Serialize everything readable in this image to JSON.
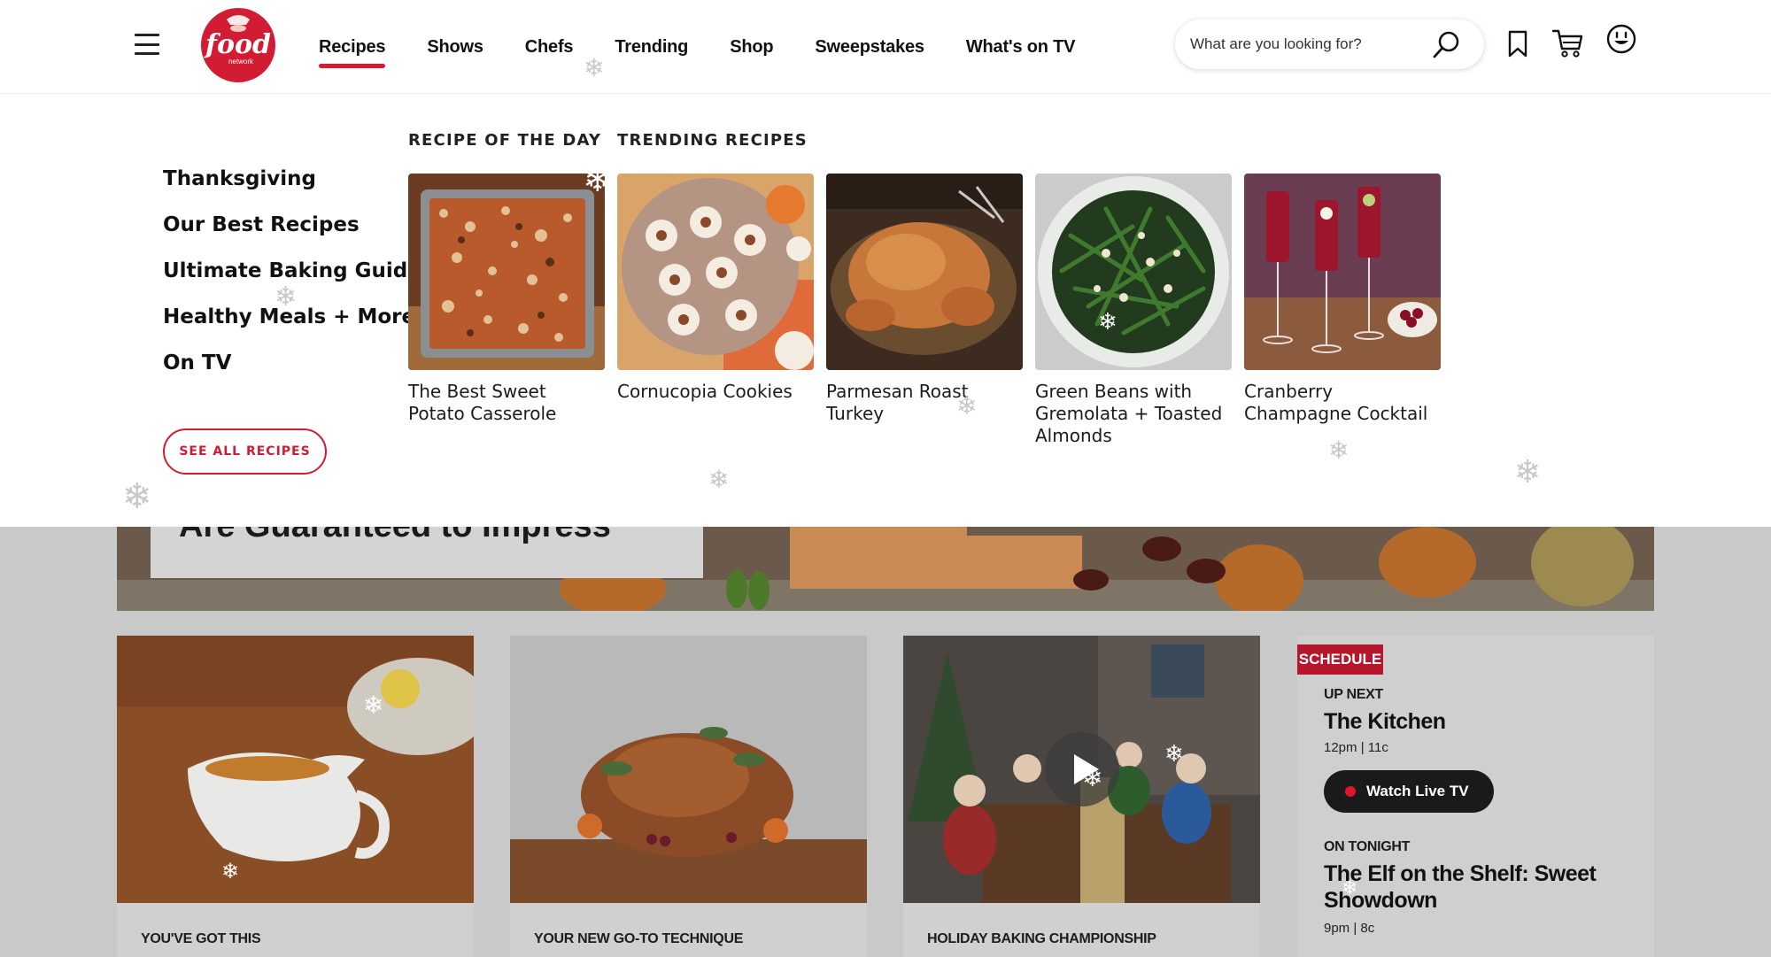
{
  "header": {
    "nav": [
      "Recipes",
      "Shows",
      "Chefs",
      "Trending",
      "Shop",
      "Sweepstakes",
      "What's on TV"
    ],
    "active_nav": "Recipes",
    "search_placeholder": "What are you looking for?",
    "brand_color": "#d21c34",
    "logo_text": [
      "food",
      "network"
    ]
  },
  "dropdown": {
    "side_items": [
      "Thanksgiving",
      "Our Best Recipes",
      "Ultimate Baking Guide",
      "Healthy Meals + More",
      "On TV"
    ],
    "see_all": "SEE ALL RECIPES",
    "recipe_of_day_label": "RECIPE OF THE DAY",
    "trending_label": "TRENDING RECIPES",
    "cards": [
      {
        "title": "The Best Sweet Potato Casserole"
      },
      {
        "title": "Cornucopia Cookies"
      },
      {
        "title": "Parmesan Roast Turkey"
      },
      {
        "title": "Green Beans with Gremolata + Toasted Almonds"
      },
      {
        "title": "Cranberry Champagne Cocktail"
      }
    ]
  },
  "page": {
    "hero_title": "Are Guaranteed to Impress",
    "promo_cards": [
      {
        "label": "YOU'VE GOT THIS"
      },
      {
        "label": "YOUR NEW GO-TO TECHNIQUE"
      },
      {
        "label": "HOLIDAY BAKING CHAMPIONSHIP"
      }
    ],
    "schedule": {
      "badge": "SCHEDULE",
      "up_next_label": "UP NEXT",
      "up_next_title": "The Kitchen",
      "up_next_time": "12pm | 11c",
      "watch_label": "Watch Live TV",
      "tonight_label": "ON TONIGHT",
      "tonight_title": "The Elf on the Shelf: Sweet Showdown",
      "tonight_time": "9pm | 8c"
    }
  }
}
